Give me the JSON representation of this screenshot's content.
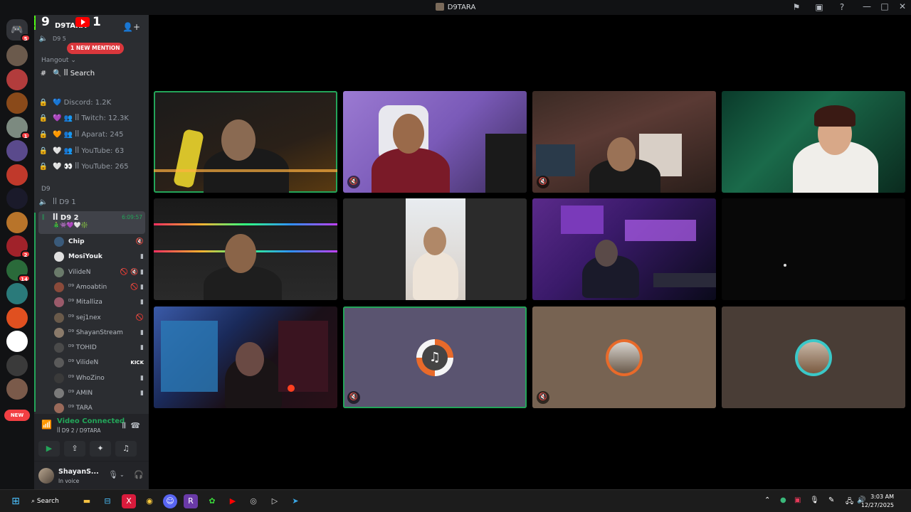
{
  "window": {
    "title": "D9TARA",
    "badge_k": "K",
    "badge_9": "9",
    "badge_1": "1"
  },
  "guilds": {
    "home_badge": "5",
    "items": [
      {
        "color": "#6b5a4c",
        "badge": ""
      },
      {
        "color": "#b23c3c",
        "badge": ""
      },
      {
        "color": "#8a4a1a",
        "badge": ""
      },
      {
        "color": "#7c8a80",
        "badge": "1"
      },
      {
        "color": "#5a4a8c",
        "badge": ""
      },
      {
        "color": "#c0392b",
        "badge": ""
      },
      {
        "color": "#1a1a2a",
        "badge": ""
      },
      {
        "color": "#b8742a",
        "badge": ""
      },
      {
        "color": "#a0222a",
        "badge": "2"
      },
      {
        "color": "#2a6a3a",
        "badge": "14"
      },
      {
        "color": "#2a7a7a",
        "badge": ""
      },
      {
        "color": "#e05020",
        "badge": ""
      },
      {
        "color": "#ffffff",
        "badge": ""
      },
      {
        "color": "#3a3a3a",
        "badge": ""
      },
      {
        "color": "#7a5a4a",
        "badge": ""
      }
    ],
    "new_label": "NEW"
  },
  "sidebar": {
    "server_name": "D9TARA",
    "mention_pill": "1 NEW MENTION",
    "top_channel": "D9 5",
    "category_hangout": "Hangout",
    "search_channel": "🔍 ꟾꟾ Search",
    "stat_channels": [
      "💙 Discord: 1.2K",
      "💜 👥 ꟾꟾ Twitch: 12.3K",
      "🧡 👥 ꟾꟾ Aparat: 245",
      "🤍 👥 ꟾꟾ YouTube: 63",
      "🤍 👀 ꟾꟾ YouTube: 265"
    ],
    "category_d9": "D9",
    "voice_channel_1": "ꟾꟾ D9 1",
    "voice_channel_2": "ꟾꟾ D9 2",
    "voice_timer": "6:09:57",
    "voice_emojis": "🎄👾💜🤍❇️",
    "voice_users": [
      {
        "name": "Chip",
        "icon": "🔇",
        "bold": true,
        "color": "#3a5a7a"
      },
      {
        "name": "MosiYouk",
        "icon": "▮",
        "bold": true,
        "color": "#e0e0e0"
      },
      {
        "name": "VilideN",
        "icon": "🚫 🔇 ▮",
        "bold": false,
        "color": "#6a7a6a"
      },
      {
        "name": "ᴰ⁹ Amoabtin",
        "icon": "🚫 ▮",
        "bold": false,
        "color": "#8a4a3a"
      },
      {
        "name": "ᴰ⁹ Mitalliza",
        "icon": "▮",
        "bold": false,
        "color": "#9a5a6a"
      },
      {
        "name": "ᴰ⁹ sej1nex",
        "icon": "🚫",
        "bold": false,
        "color": "#6a5a4a"
      },
      {
        "name": "ᴰ⁹ ShayanStream",
        "icon": "▮",
        "bold": false,
        "color": "#8a7a6a"
      },
      {
        "name": "ᴰ⁹ TOHID",
        "icon": "▮",
        "bold": false,
        "color": "#4a4a4a"
      },
      {
        "name": "ᴰ⁹ VilideN",
        "icon": "KICK",
        "bold": false,
        "color": "#5a5a5a"
      },
      {
        "name": "ᴰ⁹ WhoZino",
        "icon": "▮",
        "bold": false,
        "color": "#3a3a3a"
      },
      {
        "name": "ᴰ⁹ AMIN",
        "icon": "▮",
        "bold": false,
        "color": "#7a7a7a"
      },
      {
        "name": "ᴰ⁹ TARA",
        "icon": "",
        "bold": false,
        "color": "#9a6a5a"
      }
    ]
  },
  "voice_panel": {
    "status": "Video Connected",
    "location": "ꟾꟾ D9 2 / D9TARA"
  },
  "user_panel": {
    "name": "ShayanS...",
    "status": "In voice"
  },
  "taskbar": {
    "search": "Search",
    "time": "3:03 AM",
    "date": "12/27/2025"
  }
}
